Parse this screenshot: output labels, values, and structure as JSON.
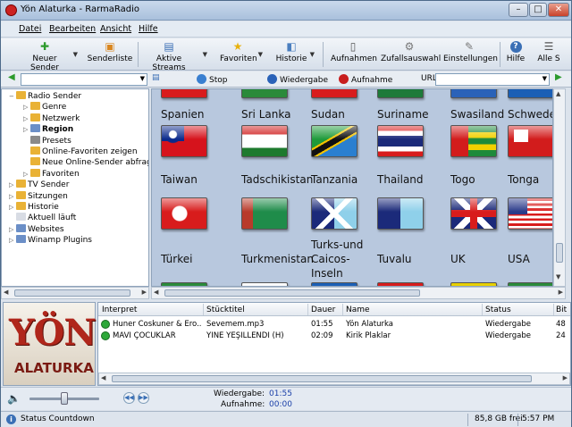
{
  "window": {
    "title": "Yön Alaturka - RarmaRadio",
    "minimize": "–",
    "maximize": "□",
    "close": "✕"
  },
  "menu": [
    "Datei",
    "Bearbeiten",
    "Ansicht",
    "Hilfe"
  ],
  "toolbar": {
    "neuer_sender": "Neuer Sender",
    "senderliste": "Senderliste",
    "aktive_streams": "Aktive Streams",
    "favoriten": "Favoriten",
    "historie": "Historie",
    "aufnahmen": "Aufnahmen",
    "zufallsauswahl": "Zufallsauswahl",
    "einstellungen": "Einstellungen",
    "hilfe": "Hilfe",
    "alle": "Alle S"
  },
  "controls": {
    "stop": "Stop",
    "wiedergabe": "Wiedergabe",
    "aufnahme": "Aufnahme",
    "url_label": "URL"
  },
  "tree": {
    "items": [
      {
        "label": "Radio Sender",
        "color": "#e9b236",
        "exp": "−"
      },
      {
        "label": "Genre",
        "color": "#e9b236",
        "exp": "▷"
      },
      {
        "label": "Netzwerk",
        "color": "#e9b236",
        "exp": "▷"
      },
      {
        "label": "Region",
        "color": "#6b8fc7",
        "exp": "▷"
      },
      {
        "label": "Presets",
        "color": "#8a8a8a",
        "exp": ""
      },
      {
        "label": "Online-Favoriten zeigen",
        "color": "#e9b236",
        "exp": ""
      },
      {
        "label": "Neue Online-Sender abfragen",
        "color": "#e9b236",
        "exp": ""
      },
      {
        "label": "Favoriten",
        "color": "#e9b236",
        "exp": "▷"
      },
      {
        "label": "TV Sender",
        "color": "#e9b236",
        "exp": "▷"
      },
      {
        "label": "Sitzungen",
        "color": "#e9b236",
        "exp": "▷"
      },
      {
        "label": "Historie",
        "color": "#e9b236",
        "exp": "▷"
      },
      {
        "label": "Aktuell läuft",
        "color": "#d8dce4",
        "exp": ""
      },
      {
        "label": "Websites",
        "color": "#6b8fc7",
        "exp": "▷"
      },
      {
        "label": "Winamp Plugins",
        "color": "#6b8fc7",
        "exp": "▷"
      }
    ]
  },
  "countries": {
    "top": [
      "Spanien",
      "Sri Lanka",
      "Sudan",
      "Suriname",
      "Swasiland",
      "Schweden"
    ],
    "row1": [
      "Taiwan",
      "Tadschikistan",
      "Tanzania",
      "Thailand",
      "Togo",
      "Tonga"
    ],
    "row2": [
      "Türkei",
      "Turkmenistan",
      "Turks-und",
      "Tuvalu",
      "UK",
      "USA"
    ],
    "row2b": [
      "Caicos-",
      "Inseln"
    ]
  },
  "logo": {
    "line1": "YÖN",
    "line2": "ALATURKA"
  },
  "table": {
    "headers": [
      "Interpret",
      "Stücktitel",
      "Dauer",
      "Name",
      "Status",
      "Bit"
    ],
    "rows": [
      [
        "Huner Coskuner & Ero...",
        "Sevemem.mp3",
        "01:55",
        "Yön Alaturka",
        "Wiedergabe",
        "48"
      ],
      [
        "MAVİ ÇOCUKLAR",
        "YİNE YEŞİLLENDİ (H)",
        "02:09",
        "Kirik Plaklar",
        "Wiedergabe",
        "24"
      ]
    ]
  },
  "player": {
    "wiedergabe_label": "Wiedergabe:",
    "wiedergabe_time": "01:55",
    "aufnahme_label": "Aufnahme:",
    "aufnahme_time": "00:00"
  },
  "statusbar": {
    "text": "Status Countdown",
    "disk": "85,8 GB frei",
    "time": "5:57 PM"
  }
}
